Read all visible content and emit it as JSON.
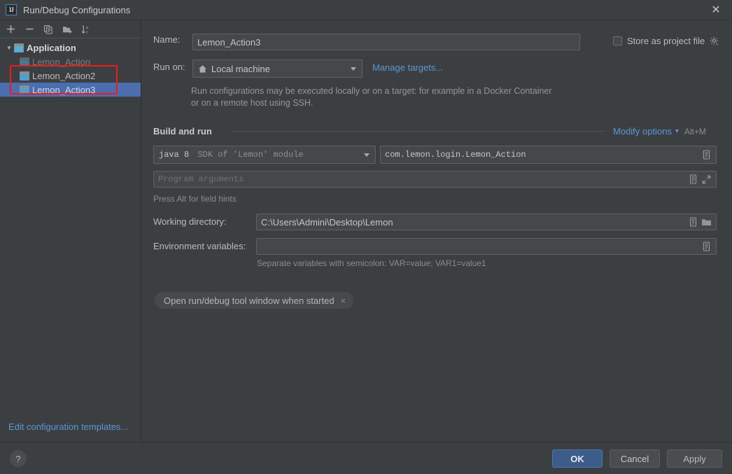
{
  "window": {
    "title": "Run/Debug Configurations",
    "logo_text": "IJ",
    "close_label": "✕"
  },
  "sidebar": {
    "toolbar": [
      {
        "name": "add-configuration-button",
        "icon": "plus-icon",
        "tooltip": "Add New Configuration"
      },
      {
        "name": "remove-configuration-button",
        "icon": "minus-icon",
        "tooltip": "Remove Configuration"
      },
      {
        "name": "copy-configuration-button",
        "icon": "copy-icon",
        "tooltip": "Copy Configuration"
      },
      {
        "name": "new-folder-button",
        "icon": "new-folder-icon",
        "tooltip": "Create New Folder"
      },
      {
        "name": "sort-configurations-button",
        "icon": "sort-az-icon",
        "tooltip": "Sort Configurations"
      }
    ],
    "tree": [
      {
        "label": "Application",
        "level": 0,
        "type": "group",
        "expanded": true,
        "state": "normal"
      },
      {
        "label": "Lemon_Action",
        "level": 1,
        "type": "configuration",
        "state": "dimmed"
      },
      {
        "label": "Lemon_Action2",
        "level": 1,
        "type": "configuration",
        "state": "normal"
      },
      {
        "label": "Lemon_Action3",
        "level": 1,
        "type": "configuration",
        "state": "selected"
      }
    ],
    "edit_templates_link": "Edit configuration templates..."
  },
  "form": {
    "name_label": "Name:",
    "name_value": "Lemon_Action3",
    "store_as_project_file_label": "Store as project file",
    "store_as_project_file_checked": false,
    "store_gear_icon": "gear-icon",
    "run_on_label": "Run on:",
    "run_on_value": "Local machine",
    "run_on_icon": "home-icon",
    "manage_targets_link": "Manage targets...",
    "target_help_text": "Run configurations may be executed locally or on a target: for example in a Docker Container or on a remote host using SSH.",
    "section_title": "Build and run",
    "modify_options_link": "Modify options",
    "modify_options_shortcut": "Alt+M",
    "sdk_value_bold": "java 8",
    "sdk_value_rest": "SDK of 'Lemon' module",
    "main_class_value": "com.lemon.login.Lemon_Action",
    "program_arguments_placeholder": "Program arguments",
    "program_arguments_value": "",
    "field_hint": "Press Alt for field hints",
    "working_directory_label": "Working directory:",
    "working_directory_value": "C:\\Users\\Admini\\Desktop\\Lemon",
    "environment_variables_label": "Environment variables:",
    "environment_variables_value": "",
    "environment_variables_hint": "Separate variables with semicolon: VAR=value; VAR1=value1",
    "option_chip_label": "Open run/debug tool window when started",
    "option_chip_remove": "×"
  },
  "footer": {
    "help_label": "?",
    "ok_label": "OK",
    "cancel_label": "Cancel",
    "apply_label": "Apply"
  },
  "annotation": {
    "color": "#f11a1a",
    "shape": "rectangle"
  },
  "colors": {
    "background": "#3c3f41",
    "selection": "#4b6eaf",
    "link": "#5c96d6",
    "ok_button": "#3c5c8a",
    "annotation_red": "#f11a1a"
  }
}
